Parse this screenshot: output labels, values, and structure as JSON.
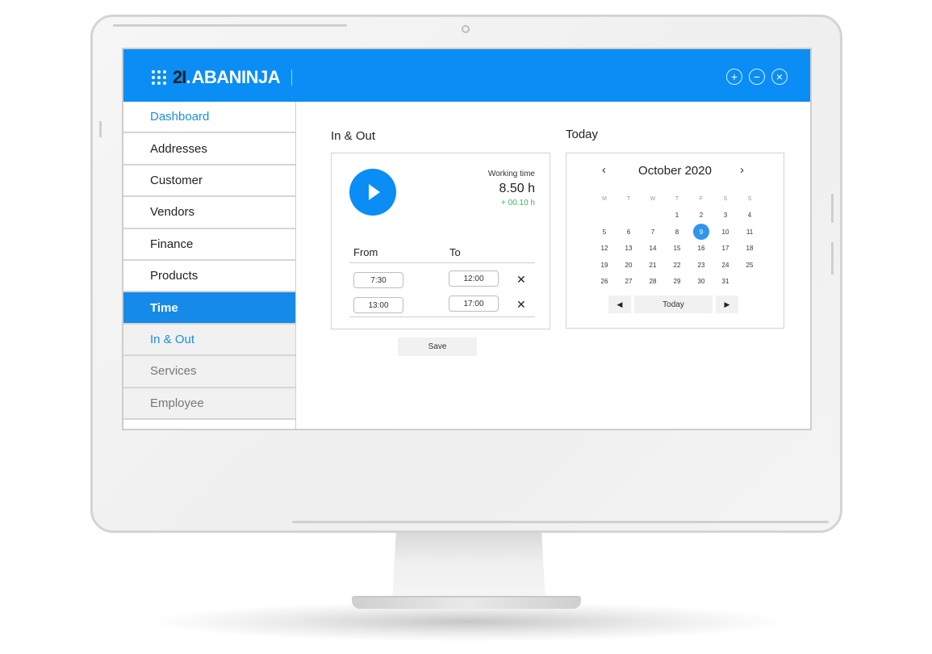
{
  "app": {
    "logo_number": "2I",
    "logo_dot": ".",
    "logo_name": "ABANINJA",
    "window_controls": [
      {
        "name": "add",
        "glyph": "+"
      },
      {
        "name": "minimize",
        "glyph": "−"
      },
      {
        "name": "close",
        "glyph": "×"
      }
    ]
  },
  "sidebar": {
    "items": [
      {
        "label": "Dashboard",
        "state": "link"
      },
      {
        "label": "Addresses",
        "state": "normal"
      },
      {
        "label": "Customer",
        "state": "normal"
      },
      {
        "label": "Vendors",
        "state": "normal"
      },
      {
        "label": "Finance",
        "state": "normal"
      },
      {
        "label": "Products",
        "state": "normal"
      },
      {
        "label": "Time",
        "state": "active"
      },
      {
        "label": "In & Out",
        "state": "sub-link"
      },
      {
        "label": "Services",
        "state": "sub"
      },
      {
        "label": "Employee",
        "state": "sub"
      }
    ]
  },
  "inout": {
    "title": "In & Out",
    "working_time_label": "Working time",
    "working_time_value": "8.50 h",
    "working_time_delta": "+ 00.10 h",
    "col_from": "From",
    "col_to": "To",
    "rows": [
      {
        "from": "7:30",
        "to": "12:00",
        "remove": "✕"
      },
      {
        "from": "13:00",
        "to": "17:00",
        "remove": "✕"
      }
    ],
    "save_label": "Save"
  },
  "calendar": {
    "title": "Today",
    "month_label": "October 2020",
    "prev": "‹",
    "next": "›",
    "weekdays": [
      "M",
      "T",
      "W",
      "T",
      "F",
      "S",
      "S"
    ],
    "leading_blanks": 3,
    "days_in_month": 31,
    "selected_day": 9,
    "footer_prev": "◀",
    "footer_today": "Today",
    "footer_next": "▶"
  },
  "colors": {
    "brand_blue": "#0a8df5",
    "active_nav": "#168ae8",
    "link_blue": "#1a8fe0",
    "positive_green": "#3bb56b",
    "selected_day": "#2f95ef"
  }
}
